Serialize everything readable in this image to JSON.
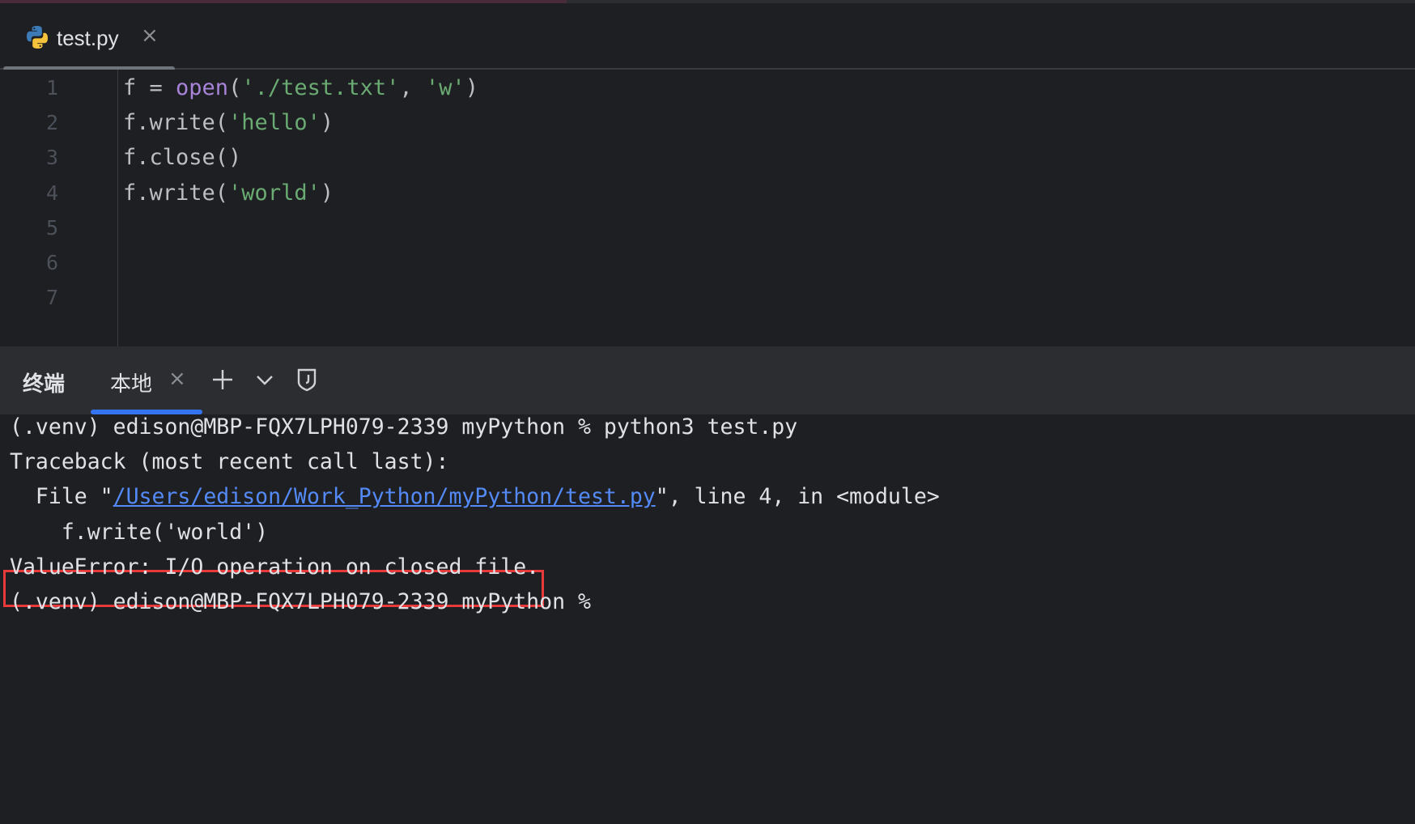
{
  "editor": {
    "tab": {
      "filename": "test.py",
      "close_glyph": "×"
    },
    "line_numbers": [
      "1",
      "2",
      "3",
      "4",
      "5",
      "6",
      "7"
    ],
    "code": [
      [
        {
          "t": "f = ",
          "c": "plain"
        },
        {
          "t": "open",
          "c": "fn"
        },
        {
          "t": "(",
          "c": "plain"
        },
        {
          "t": "'./test.txt'",
          "c": "str"
        },
        {
          "t": ", ",
          "c": "plain"
        },
        {
          "t": "'w'",
          "c": "str"
        },
        {
          "t": ")",
          "c": "plain"
        }
      ],
      [
        {
          "t": "f.write(",
          "c": "plain"
        },
        {
          "t": "'hello'",
          "c": "str"
        },
        {
          "t": ")",
          "c": "plain"
        }
      ],
      [
        {
          "t": "f.close()",
          "c": "plain"
        }
      ],
      [
        {
          "t": "f.write(",
          "c": "plain"
        },
        {
          "t": "'world'",
          "c": "str"
        },
        {
          "t": ")",
          "c": "plain"
        }
      ]
    ]
  },
  "terminal": {
    "title": "终端",
    "tab_label": "本地",
    "tab_close_glyph": "×",
    "icons": [
      "add-icon",
      "chevron-down-icon",
      "shield-icon"
    ],
    "lines": [
      {
        "text": "(.venv) edison@MBP-FQX7LPH079-2339 myPython % python3 test.py"
      },
      {
        "text": "Traceback (most recent call last):"
      },
      {
        "prefix": "  File \"",
        "link": "/Users/edison/Work_Python/myPython/test.py",
        "suffix": "\", line 4, in <module>"
      },
      {
        "text": "    f.write('world')"
      },
      {
        "text": "ValueError: I/O operation on closed file.",
        "highlighted": true
      },
      {
        "text": "(.venv) edison@MBP-FQX7LPH079-2339 myPython %"
      }
    ]
  },
  "colors": {
    "background": "#1e1f22",
    "header": "#2b2d30",
    "keyword_fn": "#a884d8",
    "string": "#6aab73",
    "link": "#548af7",
    "highlight_border": "#e8393b",
    "active_tab": "#3574f0"
  }
}
